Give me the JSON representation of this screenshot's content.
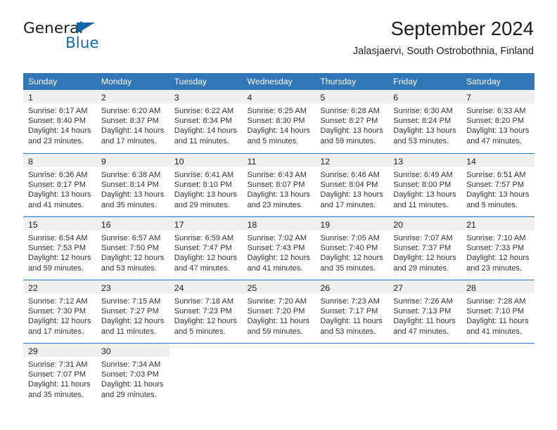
{
  "brand": {
    "name_part1": "General",
    "name_part2": "Blue",
    "triangle_color": "#1265a8",
    "blue_color": "#1668ad"
  },
  "header": {
    "title": "September 2024",
    "subtitle": "Jalasjaervi, South Ostrobothnia, Finland"
  },
  "theme": {
    "header_blue": "#3075b6",
    "daynum_band": "#f0f0f0",
    "text": "#333333"
  },
  "calendar": {
    "weekday_headers": [
      "Sunday",
      "Monday",
      "Tuesday",
      "Wednesday",
      "Thursday",
      "Friday",
      "Saturday"
    ],
    "weeks": [
      [
        {
          "day": "1",
          "sunrise": "Sunrise: 6:17 AM",
          "sunset": "Sunset: 8:40 PM",
          "daylight_line1": "Daylight: 14 hours",
          "daylight_line2": "and 23 minutes."
        },
        {
          "day": "2",
          "sunrise": "Sunrise: 6:20 AM",
          "sunset": "Sunset: 8:37 PM",
          "daylight_line1": "Daylight: 14 hours",
          "daylight_line2": "and 17 minutes."
        },
        {
          "day": "3",
          "sunrise": "Sunrise: 6:22 AM",
          "sunset": "Sunset: 8:34 PM",
          "daylight_line1": "Daylight: 14 hours",
          "daylight_line2": "and 11 minutes."
        },
        {
          "day": "4",
          "sunrise": "Sunrise: 6:25 AM",
          "sunset": "Sunset: 8:30 PM",
          "daylight_line1": "Daylight: 14 hours",
          "daylight_line2": "and 5 minutes."
        },
        {
          "day": "5",
          "sunrise": "Sunrise: 6:28 AM",
          "sunset": "Sunset: 8:27 PM",
          "daylight_line1": "Daylight: 13 hours",
          "daylight_line2": "and 59 minutes."
        },
        {
          "day": "6",
          "sunrise": "Sunrise: 6:30 AM",
          "sunset": "Sunset: 8:24 PM",
          "daylight_line1": "Daylight: 13 hours",
          "daylight_line2": "and 53 minutes."
        },
        {
          "day": "7",
          "sunrise": "Sunrise: 6:33 AM",
          "sunset": "Sunset: 8:20 PM",
          "daylight_line1": "Daylight: 13 hours",
          "daylight_line2": "and 47 minutes."
        }
      ],
      [
        {
          "day": "8",
          "sunrise": "Sunrise: 6:36 AM",
          "sunset": "Sunset: 8:17 PM",
          "daylight_line1": "Daylight: 13 hours",
          "daylight_line2": "and 41 minutes."
        },
        {
          "day": "9",
          "sunrise": "Sunrise: 6:38 AM",
          "sunset": "Sunset: 8:14 PM",
          "daylight_line1": "Daylight: 13 hours",
          "daylight_line2": "and 35 minutes."
        },
        {
          "day": "10",
          "sunrise": "Sunrise: 6:41 AM",
          "sunset": "Sunset: 8:10 PM",
          "daylight_line1": "Daylight: 13 hours",
          "daylight_line2": "and 29 minutes."
        },
        {
          "day": "11",
          "sunrise": "Sunrise: 6:43 AM",
          "sunset": "Sunset: 8:07 PM",
          "daylight_line1": "Daylight: 13 hours",
          "daylight_line2": "and 23 minutes."
        },
        {
          "day": "12",
          "sunrise": "Sunrise: 6:46 AM",
          "sunset": "Sunset: 8:04 PM",
          "daylight_line1": "Daylight: 13 hours",
          "daylight_line2": "and 17 minutes."
        },
        {
          "day": "13",
          "sunrise": "Sunrise: 6:49 AM",
          "sunset": "Sunset: 8:00 PM",
          "daylight_line1": "Daylight: 13 hours",
          "daylight_line2": "and 11 minutes."
        },
        {
          "day": "14",
          "sunrise": "Sunrise: 6:51 AM",
          "sunset": "Sunset: 7:57 PM",
          "daylight_line1": "Daylight: 13 hours",
          "daylight_line2": "and 5 minutes."
        }
      ],
      [
        {
          "day": "15",
          "sunrise": "Sunrise: 6:54 AM",
          "sunset": "Sunset: 7:53 PM",
          "daylight_line1": "Daylight: 12 hours",
          "daylight_line2": "and 59 minutes."
        },
        {
          "day": "16",
          "sunrise": "Sunrise: 6:57 AM",
          "sunset": "Sunset: 7:50 PM",
          "daylight_line1": "Daylight: 12 hours",
          "daylight_line2": "and 53 minutes."
        },
        {
          "day": "17",
          "sunrise": "Sunrise: 6:59 AM",
          "sunset": "Sunset: 7:47 PM",
          "daylight_line1": "Daylight: 12 hours",
          "daylight_line2": "and 47 minutes."
        },
        {
          "day": "18",
          "sunrise": "Sunrise: 7:02 AM",
          "sunset": "Sunset: 7:43 PM",
          "daylight_line1": "Daylight: 12 hours",
          "daylight_line2": "and 41 minutes."
        },
        {
          "day": "19",
          "sunrise": "Sunrise: 7:05 AM",
          "sunset": "Sunset: 7:40 PM",
          "daylight_line1": "Daylight: 12 hours",
          "daylight_line2": "and 35 minutes."
        },
        {
          "day": "20",
          "sunrise": "Sunrise: 7:07 AM",
          "sunset": "Sunset: 7:37 PM",
          "daylight_line1": "Daylight: 12 hours",
          "daylight_line2": "and 29 minutes."
        },
        {
          "day": "21",
          "sunrise": "Sunrise: 7:10 AM",
          "sunset": "Sunset: 7:33 PM",
          "daylight_line1": "Daylight: 12 hours",
          "daylight_line2": "and 23 minutes."
        }
      ],
      [
        {
          "day": "22",
          "sunrise": "Sunrise: 7:12 AM",
          "sunset": "Sunset: 7:30 PM",
          "daylight_line1": "Daylight: 12 hours",
          "daylight_line2": "and 17 minutes."
        },
        {
          "day": "23",
          "sunrise": "Sunrise: 7:15 AM",
          "sunset": "Sunset: 7:27 PM",
          "daylight_line1": "Daylight: 12 hours",
          "daylight_line2": "and 11 minutes."
        },
        {
          "day": "24",
          "sunrise": "Sunrise: 7:18 AM",
          "sunset": "Sunset: 7:23 PM",
          "daylight_line1": "Daylight: 12 hours",
          "daylight_line2": "and 5 minutes."
        },
        {
          "day": "25",
          "sunrise": "Sunrise: 7:20 AM",
          "sunset": "Sunset: 7:20 PM",
          "daylight_line1": "Daylight: 11 hours",
          "daylight_line2": "and 59 minutes."
        },
        {
          "day": "26",
          "sunrise": "Sunrise: 7:23 AM",
          "sunset": "Sunset: 7:17 PM",
          "daylight_line1": "Daylight: 11 hours",
          "daylight_line2": "and 53 minutes."
        },
        {
          "day": "27",
          "sunrise": "Sunrise: 7:26 AM",
          "sunset": "Sunset: 7:13 PM",
          "daylight_line1": "Daylight: 11 hours",
          "daylight_line2": "and 47 minutes."
        },
        {
          "day": "28",
          "sunrise": "Sunrise: 7:28 AM",
          "sunset": "Sunset: 7:10 PM",
          "daylight_line1": "Daylight: 11 hours",
          "daylight_line2": "and 41 minutes."
        }
      ],
      [
        {
          "day": "29",
          "sunrise": "Sunrise: 7:31 AM",
          "sunset": "Sunset: 7:07 PM",
          "daylight_line1": "Daylight: 11 hours",
          "daylight_line2": "and 35 minutes."
        },
        {
          "day": "30",
          "sunrise": "Sunrise: 7:34 AM",
          "sunset": "Sunset: 7:03 PM",
          "daylight_line1": "Daylight: 11 hours",
          "daylight_line2": "and 29 minutes."
        },
        {
          "day": "",
          "sunrise": "",
          "sunset": "",
          "daylight_line1": "",
          "daylight_line2": ""
        },
        {
          "day": "",
          "sunrise": "",
          "sunset": "",
          "daylight_line1": "",
          "daylight_line2": ""
        },
        {
          "day": "",
          "sunrise": "",
          "sunset": "",
          "daylight_line1": "",
          "daylight_line2": ""
        },
        {
          "day": "",
          "sunrise": "",
          "sunset": "",
          "daylight_line1": "",
          "daylight_line2": ""
        },
        {
          "day": "",
          "sunrise": "",
          "sunset": "",
          "daylight_line1": "",
          "daylight_line2": ""
        }
      ]
    ]
  }
}
